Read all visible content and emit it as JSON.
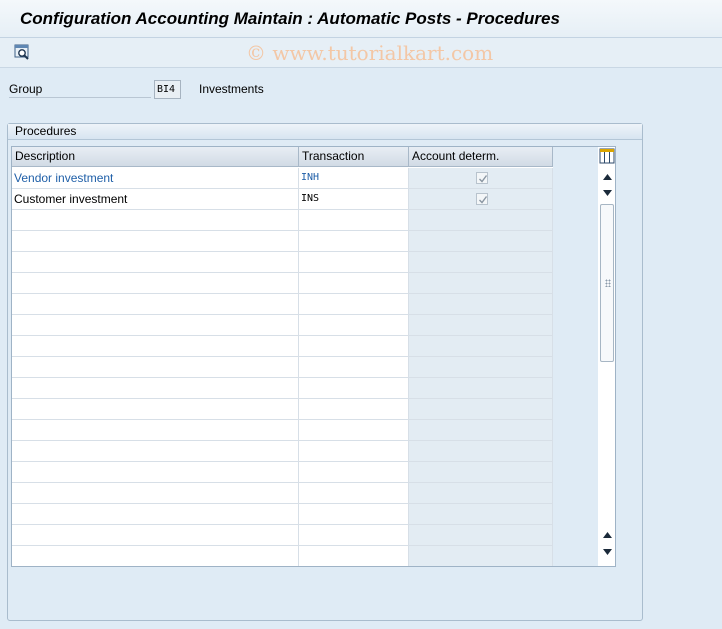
{
  "window": {
    "title": "Configuration Accounting Maintain : Automatic Posts - Procedures"
  },
  "toolbar": {
    "watermark": "© www.tutorialkart.com",
    "buttons": [
      {
        "icon": "find-icon"
      }
    ]
  },
  "selection": {
    "group_label": "Group",
    "group_value": "BI4",
    "group_description": "Investments"
  },
  "procedures": {
    "frame_title": "Procedures",
    "columns": [
      "Description",
      "Transaction",
      "Account determ."
    ],
    "rows": [
      {
        "description": "Vendor investment",
        "transaction": "INH",
        "account_determination": true
      },
      {
        "description": "Customer investment",
        "transaction": "INS",
        "account_determination": true
      }
    ]
  },
  "colors": {
    "background": "#dfebf5",
    "link": "#1f5fa8",
    "header": "#d1dbe5"
  }
}
